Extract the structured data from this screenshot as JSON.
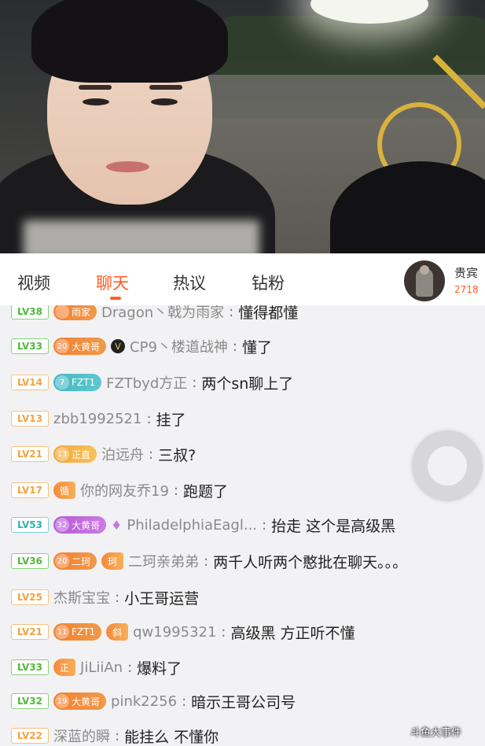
{
  "tabs": [
    {
      "label": "视频"
    },
    {
      "label": "聊天"
    },
    {
      "label": "热议"
    },
    {
      "label": "钻粉"
    }
  ],
  "vip": {
    "label": "贵宾",
    "count": "2718"
  },
  "chat": [
    {
      "lv": "LV38",
      "lvColor": "green",
      "badge": {
        "num": "",
        "text": "雨家",
        "color": "orange"
      },
      "fans": "",
      "name": "Dragon丶戟为雨家",
      "message": "懂得都懂"
    },
    {
      "lv": "LV33",
      "lvColor": "green",
      "badge": {
        "num": "20",
        "text": "大黄哥",
        "color": "orange"
      },
      "vmark": "V",
      "name": "CP9丶楼道战神",
      "message": "懂了"
    },
    {
      "lv": "LV14",
      "lvColor": "orange",
      "badge": {
        "num": "7",
        "text": "FZT1",
        "color": "teal"
      },
      "name": "FZTbyd方正",
      "message": "两个sn聊上了"
    },
    {
      "lv": "LV13",
      "lvColor": "orange",
      "name": "zbb1992521",
      "message": "挂了"
    },
    {
      "lv": "LV21",
      "lvColor": "orange",
      "badge": {
        "num": "13",
        "text": "正直",
        "color": "yellow"
      },
      "name": "泊远舟",
      "message": "三叔?"
    },
    {
      "lv": "LV17",
      "lvColor": "orange",
      "fans": "循",
      "name": "你的网友乔19",
      "message": "跑题了"
    },
    {
      "lv": "LV53",
      "lvColor": "teal",
      "badge": {
        "num": "32",
        "text": "大黄哥",
        "color": "purple"
      },
      "diamond": "♦",
      "name": "PhiladelphiaEagl...",
      "message": "抬走 这个是高级黑"
    },
    {
      "lv": "LV36",
      "lvColor": "green",
      "badge": {
        "num": "20",
        "text": "二珂",
        "color": "orange"
      },
      "fans": "珂",
      "name": "二珂亲弟弟",
      "message": "两千人听两个憨批在聊天。。。"
    },
    {
      "lv": "LV25",
      "lvColor": "orange",
      "name": "杰斯宝宝",
      "message": "小王哥运营"
    },
    {
      "lv": "LV21",
      "lvColor": "orange",
      "badge": {
        "num": "11",
        "text": "FZT1",
        "color": "orange"
      },
      "fans": "斜",
      "name": "qw1995321",
      "message": "高级黑 方正听不懂"
    },
    {
      "lv": "LV33",
      "lvColor": "green",
      "fans": "正",
      "name": "JiLiiAn",
      "message": "爆料了"
    },
    {
      "lv": "LV32",
      "lvColor": "green",
      "badge": {
        "num": "19",
        "text": "大黄哥",
        "color": "orange"
      },
      "name": "pink2256",
      "message": "暗示王哥公司号"
    },
    {
      "lv": "LV22",
      "lvColor": "orange",
      "name": "深蓝的瞬",
      "message": "能挂么 不懂你"
    }
  ],
  "watermark": "斗鱼大事件"
}
